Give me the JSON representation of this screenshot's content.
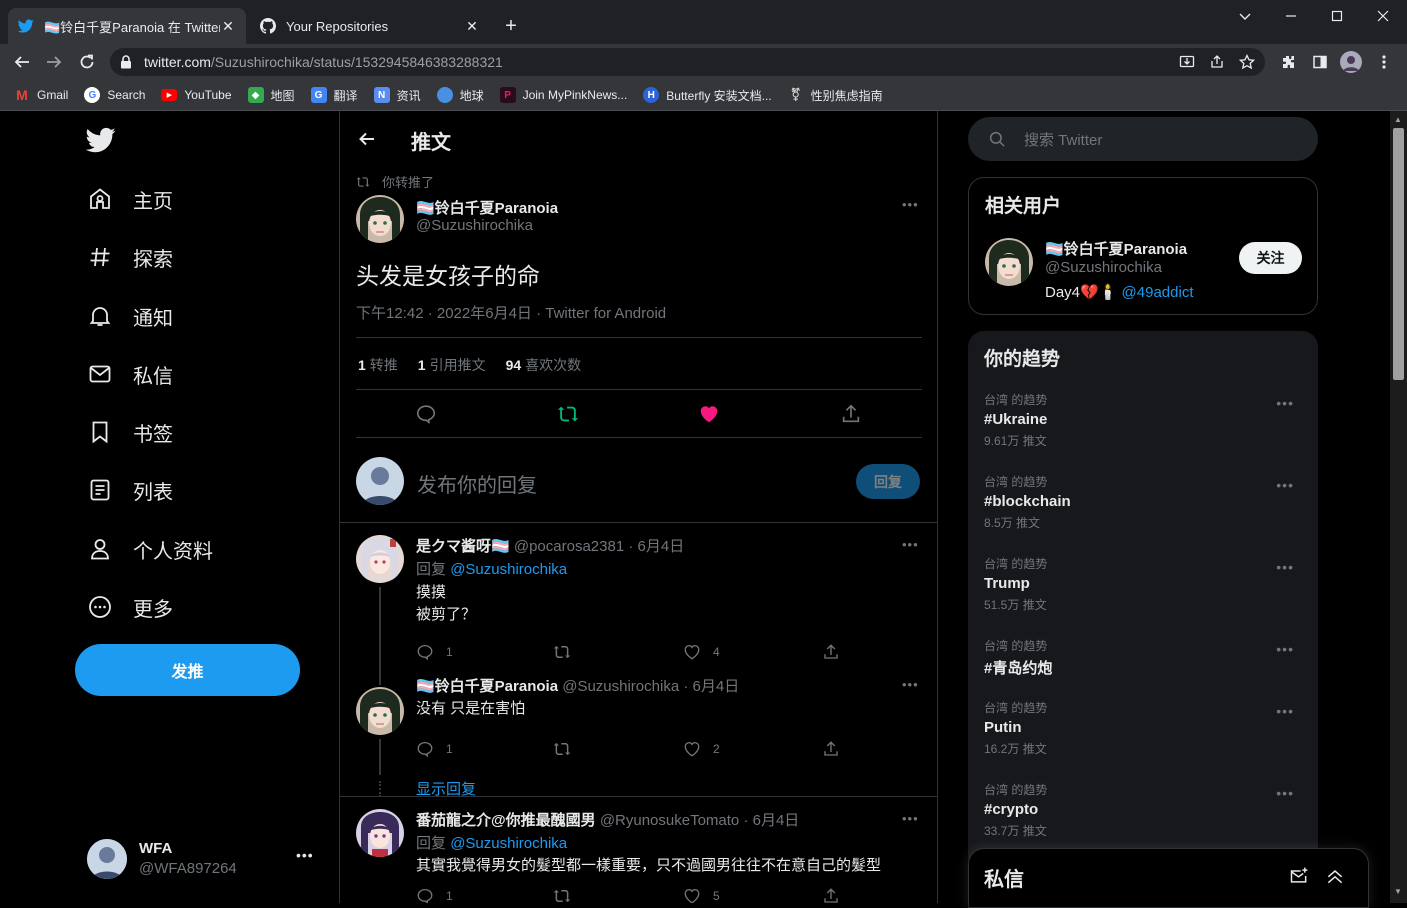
{
  "browser": {
    "tabs": [
      {
        "title": "🏳️‍⚧️铃白千夏Paranoia 在 Twitter",
        "active": true
      },
      {
        "title": "Your Repositories",
        "active": false
      }
    ],
    "url_host": "twitter.com",
    "url_path": "/Suzushirochika/status/1532945846383288321",
    "bookmarks": [
      {
        "label": "Gmail",
        "icon": "gmail-icon",
        "color": "#ea4335"
      },
      {
        "label": "Search",
        "icon": "google-icon",
        "color": "#4285f4"
      },
      {
        "label": "YouTube",
        "icon": "youtube-icon",
        "color": "#ff0000"
      },
      {
        "label": "地图",
        "icon": "maps-icon",
        "color": "#34a853"
      },
      {
        "label": "翻译",
        "icon": "translate-icon",
        "color": "#4285f4"
      },
      {
        "label": "资讯",
        "icon": "news-icon",
        "color": "#5b8def"
      },
      {
        "label": "地球",
        "icon": "earth-icon",
        "color": "#4a90e2"
      },
      {
        "label": "Join MyPinkNews...",
        "icon": "pinknews-icon",
        "color": "#e91e63"
      },
      {
        "label": "Butterfly 安装文档...",
        "icon": "butterfly-icon",
        "color": "#2b63d9"
      },
      {
        "label": "性别焦虑指南",
        "icon": "genderdysphoria-icon",
        "color": "#cccccc"
      }
    ]
  },
  "nav": {
    "items": [
      {
        "label": "主页",
        "icon": "home-icon"
      },
      {
        "label": "探索",
        "icon": "hashtag-icon"
      },
      {
        "label": "通知",
        "icon": "bell-icon"
      },
      {
        "label": "私信",
        "icon": "mail-icon"
      },
      {
        "label": "书签",
        "icon": "bookmark-icon"
      },
      {
        "label": "列表",
        "icon": "list-icon"
      },
      {
        "label": "个人资料",
        "icon": "profile-icon"
      },
      {
        "label": "更多",
        "icon": "more-circle-icon"
      }
    ],
    "tweet_button": "发推",
    "account": {
      "name": "WFA",
      "handle": "@WFA897264"
    }
  },
  "header": {
    "title": "推文"
  },
  "tweet": {
    "retweeted_label": "你转推了",
    "author_name": "🏳️‍⚧️铃白千夏Paranoia",
    "author_handle": "@Suzushirochika",
    "text": "头发是女孩子的命",
    "meta": "下午12:42 · 2022年6月4日 · Twitter for Android",
    "stats": {
      "retweets_count": "1",
      "retweets_label": "转推",
      "quotes_count": "1",
      "quotes_label": "引用推文",
      "likes_count": "94",
      "likes_label": "喜欢次数"
    }
  },
  "compose": {
    "placeholder": "发布你的回复",
    "button": "回复"
  },
  "replies": [
    {
      "name": "是クマ酱呀🏳️‍⚧️",
      "handle": "@pocarosa2381",
      "date": "· 6月4日",
      "reply_prefix": "回复",
      "reply_to": "@Suzushirochika",
      "lines": [
        "摸摸",
        "被剪了？"
      ],
      "reply_count": "1",
      "like_count": "4"
    },
    {
      "name": "🏳️‍⚧️铃白千夏Paranoia",
      "handle": "@Suzushirochika",
      "date": "· 6月4日",
      "lines": [
        "没有 只是在害怕"
      ],
      "reply_count": "1",
      "like_count": "2",
      "show_replies": "显示回复"
    },
    {
      "name": "番茄龍之介@你推最醜國男",
      "handle": "@RyunosukeTomato",
      "date": "· 6月4日",
      "reply_prefix": "回复",
      "reply_to": "@Suzushirochika",
      "lines": [
        "其實我覺得男女的髮型都一樣重要，只不過國男往往不在意自己的髮型"
      ],
      "reply_count": "1",
      "like_count": "5"
    }
  ],
  "sidebar": {
    "search_placeholder": "搜索 Twitter",
    "related": {
      "title": "相关用户",
      "name": "🏳️‍⚧️铃白千夏Paranoia",
      "handle": "@Suzushirochika",
      "bio_text": "Day4💔🕯️",
      "bio_link": "@49addict",
      "follow": "关注"
    },
    "trends_title": "你的趋势",
    "trends": [
      {
        "context": "台湾 的趋势",
        "name": "#Ukraine",
        "count": "9.61万 推文"
      },
      {
        "context": "台湾 的趋势",
        "name": "#blockchain",
        "count": "8.5万 推文"
      },
      {
        "context": "台湾 的趋势",
        "name": "Trump",
        "count": "51.5万 推文"
      },
      {
        "context": "台湾 的趋势",
        "name": "#青岛约炮",
        "count": ""
      },
      {
        "context": "台湾 的趋势",
        "name": "Putin",
        "count": "16.2万 推文"
      },
      {
        "context": "台湾 的趋势",
        "name": "#crypto",
        "count": "33.7万 推文"
      }
    ],
    "dm_title": "私信"
  },
  "colors": {
    "accent": "#1d9bf0",
    "like": "#f91880",
    "retweet": "#00ba7c",
    "background": "#000000"
  }
}
